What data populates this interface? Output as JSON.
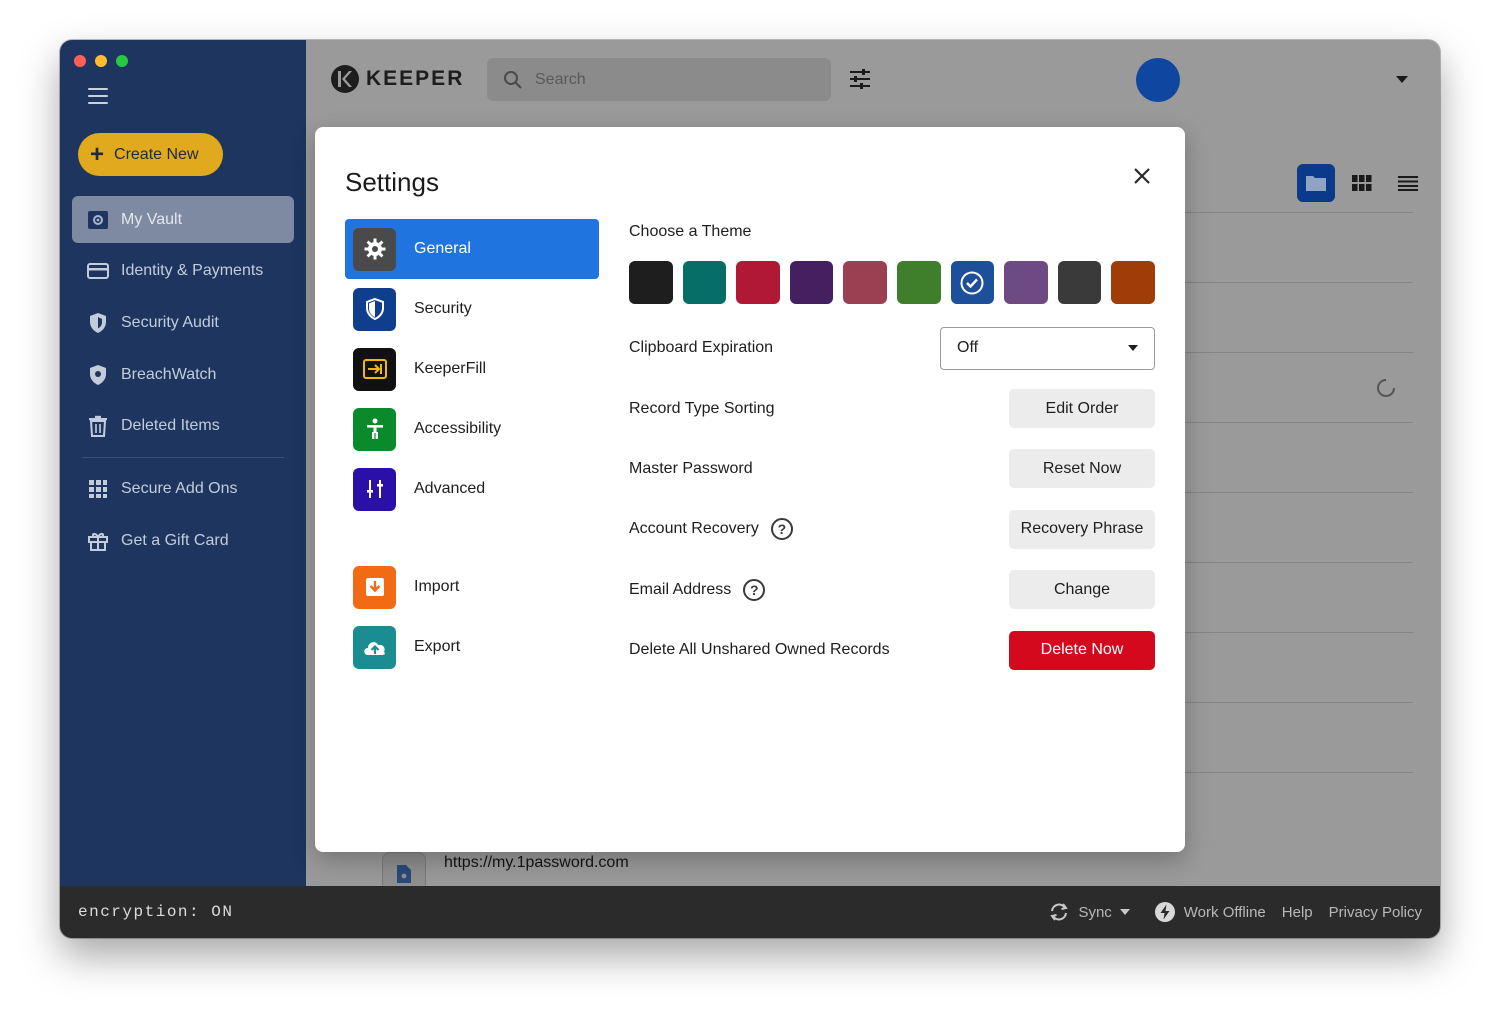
{
  "sidebar": {
    "create_label": "Create New",
    "items": [
      {
        "label": "My Vault"
      },
      {
        "label": "Identity & Payments"
      },
      {
        "label": "Security Audit"
      },
      {
        "label": "BreachWatch"
      },
      {
        "label": "Deleted Items"
      },
      {
        "label": "Secure Add Ons"
      },
      {
        "label": "Get a Gift Card"
      }
    ]
  },
  "header": {
    "logo_text": "KEEPER",
    "search_placeholder": "Search"
  },
  "background": {
    "record_url": "https://my.1password.com"
  },
  "settings": {
    "title": "Settings",
    "tabs": [
      {
        "label": "General",
        "icon": "gear-icon",
        "color": "#4a4a4a"
      },
      {
        "label": "Security",
        "icon": "shield-icon",
        "color": "#0f3f8c"
      },
      {
        "label": "KeeperFill",
        "icon": "keeperfill-icon",
        "color": "#111111"
      },
      {
        "label": "Accessibility",
        "icon": "accessibility-icon",
        "color": "#0b8a2c"
      },
      {
        "label": "Advanced",
        "icon": "sliders-icon",
        "color": "#2a10a8"
      },
      {
        "label": "Import",
        "icon": "import-icon",
        "color": "#f26a14"
      },
      {
        "label": "Export",
        "icon": "cloud-upload-icon",
        "color": "#1a8c92"
      }
    ],
    "theme_label": "Choose a Theme",
    "themes": [
      "#1e1e1e",
      "#066e66",
      "#b01835",
      "#442060",
      "#9a4052",
      "#3f7e2a",
      "#1e4f9a",
      "#6e4a82",
      "#3a3a3a",
      "#a03c08"
    ],
    "selected_theme_index": 6,
    "rows": {
      "clipboard": {
        "label": "Clipboard Expiration",
        "value": "Off"
      },
      "sorting": {
        "label": "Record Type Sorting",
        "button": "Edit Order"
      },
      "master": {
        "label": "Master Password",
        "button": "Reset Now"
      },
      "recovery": {
        "label": "Account Recovery",
        "button": "Recovery Phrase"
      },
      "email": {
        "label": "Email Address",
        "button": "Change"
      },
      "delete": {
        "label": "Delete All Unshared Owned Records",
        "button": "Delete Now"
      }
    }
  },
  "footer": {
    "encryption": "encryption: ON",
    "sync": "Sync",
    "offline": "Work Offline",
    "help": "Help",
    "privacy": "Privacy Policy"
  }
}
